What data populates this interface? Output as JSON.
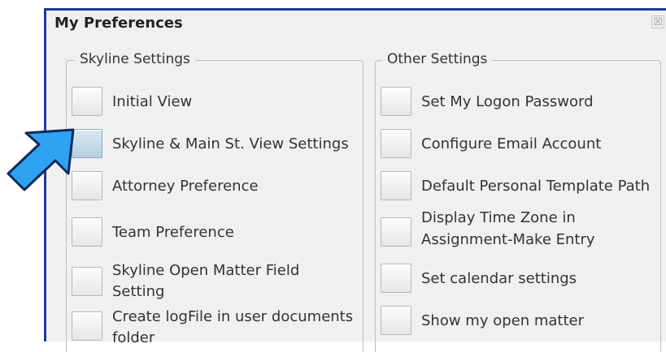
{
  "window": {
    "title": "My Preferences",
    "close_glyph": "☒"
  },
  "skyline_settings": {
    "legend": "Skyline Settings",
    "items": [
      {
        "line1": "Initial View",
        "line2": ""
      },
      {
        "line1": "Skyline & Main St. View Settings",
        "line2": ""
      },
      {
        "line1": "Attorney Preference",
        "line2": ""
      },
      {
        "line1": "Team Preference",
        "line2": ""
      },
      {
        "line1": "Skyline Open Matter Field",
        "line2": "Setting"
      },
      {
        "line1": "Create logFile in user documents",
        "line2": "folder"
      }
    ]
  },
  "other_settings": {
    "legend": "Other Settings",
    "items": [
      {
        "line1": "Set My Logon Password",
        "line2": ""
      },
      {
        "line1": "Configure Email Account",
        "line2": ""
      },
      {
        "line1": "Default Personal Template Path",
        "line2": ""
      },
      {
        "line1": "Display Time Zone in",
        "line2": "Assignment-Make Entry"
      },
      {
        "line1": "Set calendar settings",
        "line2": ""
      },
      {
        "line1": "Show my open matter",
        "line2": ""
      }
    ]
  },
  "colors": {
    "window_border": "#1f3a93",
    "arrow_fill": "#2ea3f2",
    "arrow_stroke": "#0d2a5c",
    "hover_button": "#b7cfdf"
  },
  "icons": {
    "pointer": "pointer-arrow-icon",
    "close": "close-icon"
  }
}
